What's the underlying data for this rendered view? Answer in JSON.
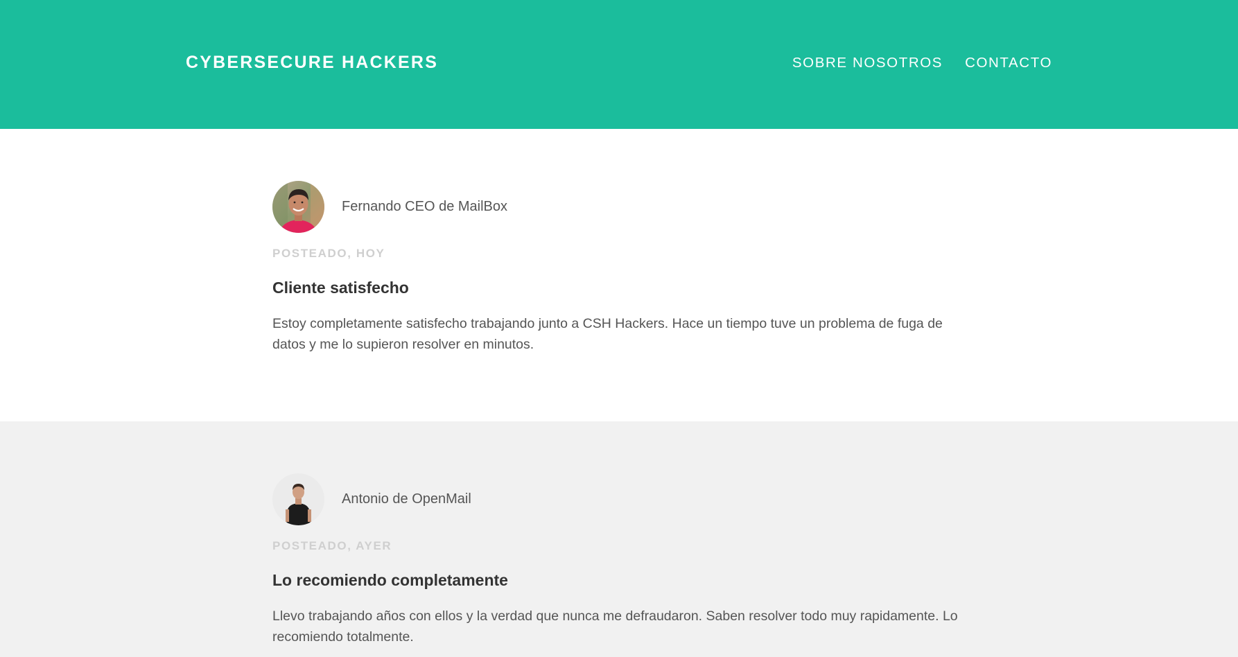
{
  "header": {
    "brand": "CYBERSECURE HACKERS",
    "nav": [
      "SOBRE NOSOTROS",
      "CONTACTO"
    ],
    "bg_color": "#1bbd9c"
  },
  "posts": [
    {
      "author": "Fernando CEO de MailBox",
      "avatar": "fernando-avatar",
      "posted": "POSTEADO, HOY",
      "title": "Cliente satisfecho",
      "text": "Estoy completamente satisfecho trabajando junto a CSH Hackers. Hace un tiempo tuve un problema de fuga de datos y me lo supieron resolver en minutos."
    },
    {
      "author": "Antonio de OpenMail",
      "avatar": "antonio-avatar",
      "posted": "POSTEADO, AYER",
      "title": "Lo recomiendo completamente",
      "text": "Llevo trabajando años con ellos y la verdad que nunca me defraudaron. Saben resolver todo muy rapidamente. Lo recomiendo totalmente."
    }
  ]
}
